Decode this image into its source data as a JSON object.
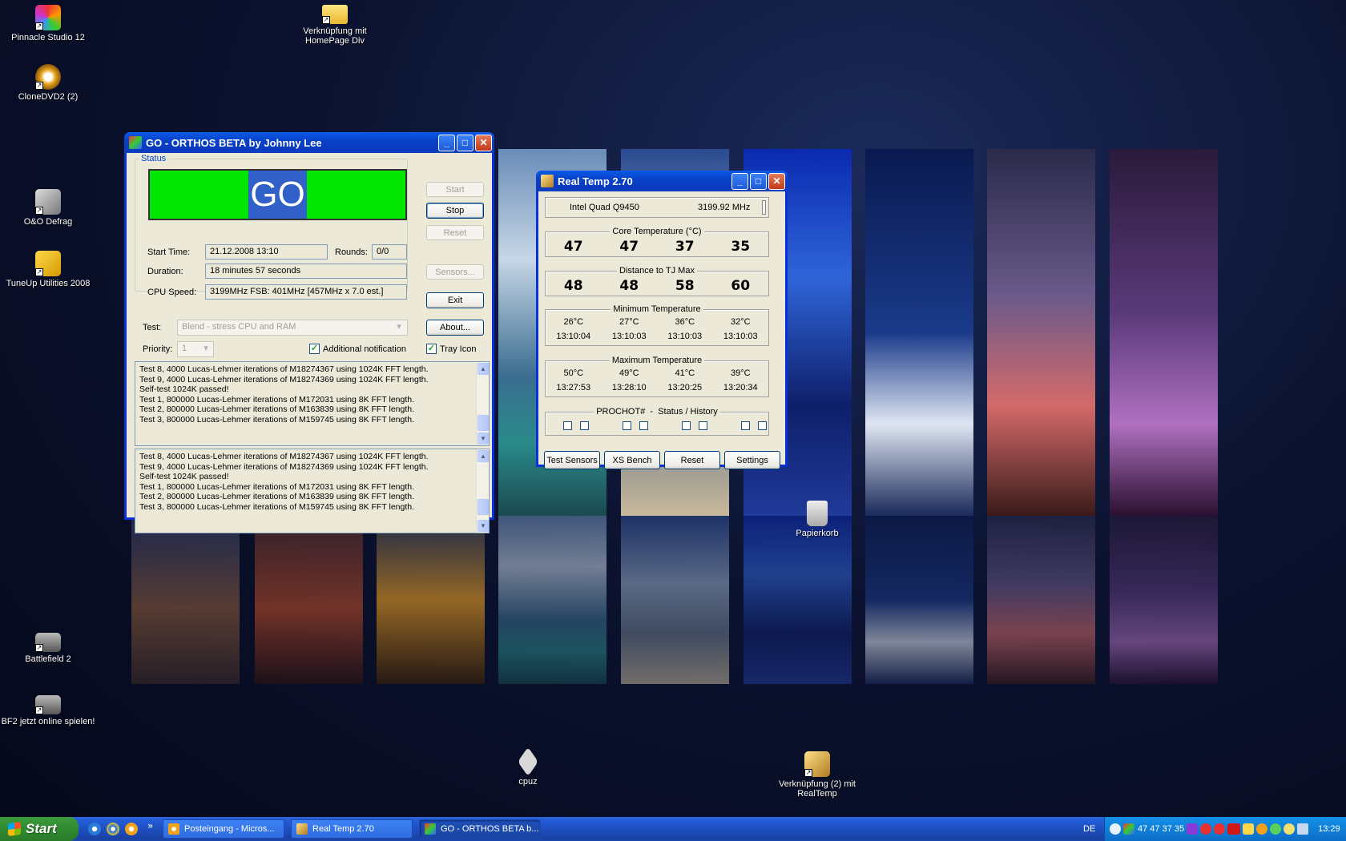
{
  "desktop": {
    "icons": [
      {
        "label": "Pinnacle Studio 12"
      },
      {
        "label": "CloneDVD2 (2)"
      },
      {
        "label": "O&O Defrag"
      },
      {
        "label": "TuneUp Utilities 2008"
      },
      {
        "label": "Battlefield 2"
      },
      {
        "label": "BF2 jetzt online spielen!"
      },
      {
        "label": "Verknüpfung mit HomePage Div"
      },
      {
        "label": "Papierkorb"
      },
      {
        "label": "cpuz"
      },
      {
        "label": "Verknüpfung (2) mit RealTemp"
      }
    ]
  },
  "orthos": {
    "title": "GO - ORTHOS BETA by Johnny Lee",
    "status_group": "Status",
    "status_text": "GO",
    "status_color": "#00e600",
    "start_label": "Start",
    "stop_label": "Stop",
    "reset_label": "Reset",
    "sensors_label": "Sensors...",
    "exit_label": "Exit",
    "about_label": "About...",
    "start_time_label": "Start Time:",
    "start_time": "21.12.2008 13:10",
    "rounds_label": "Rounds:",
    "rounds": "0/0",
    "duration_label": "Duration:",
    "duration": "18 minutes 57 seconds",
    "cpu_speed_label": "CPU Speed:",
    "cpu_speed": "3199MHz FSB: 401MHz [457MHz x 7.0 est.]",
    "test_label": "Test:",
    "test_value": "Blend - stress CPU and RAM",
    "priority_label": "Priority:",
    "priority_value": "1",
    "additional_notification": "Additional notification",
    "tray_icon": "Tray Icon",
    "log1": [
      "Test 8, 4000 Lucas-Lehmer iterations of M18274367 using 1024K FFT length.",
      "Test 9, 4000 Lucas-Lehmer iterations of M18274369 using 1024K FFT length.",
      "Self-test 1024K passed!",
      "Test 1, 800000 Lucas-Lehmer iterations of M172031 using 8K FFT length.",
      "Test 2, 800000 Lucas-Lehmer iterations of M163839 using 8K FFT length.",
      "Test 3, 800000 Lucas-Lehmer iterations of M159745 using 8K FFT length."
    ],
    "log2": [
      "Test 8, 4000 Lucas-Lehmer iterations of M18274367 using 1024K FFT length.",
      "Test 9, 4000 Lucas-Lehmer iterations of M18274369 using 1024K FFT length.",
      "Self-test 1024K passed!",
      "Test 1, 800000 Lucas-Lehmer iterations of M172031 using 8K FFT length.",
      "Test 2, 800000 Lucas-Lehmer iterations of M163839 using 8K FFT length.",
      "Test 3, 800000 Lucas-Lehmer iterations of M159745 using 8K FFT length."
    ]
  },
  "realtemp": {
    "title": "Real Temp 2.70",
    "cpu_name": "Intel Quad Q9450",
    "cpu_mhz": "3199.92 MHz",
    "core_temp_title": "Core Temperature (°C)",
    "core_temps": [
      "47",
      "47",
      "37",
      "35"
    ],
    "tjmax_title": "Distance to TJ Max",
    "tjmax": [
      "48",
      "48",
      "58",
      "60"
    ],
    "min_title": "Minimum Temperature",
    "min_temps": [
      "26°C",
      "27°C",
      "36°C",
      "32°C"
    ],
    "min_times": [
      "13:10:04",
      "13:10:03",
      "13:10:03",
      "13:10:03"
    ],
    "max_title": "Maximum Temperature",
    "max_temps": [
      "50°C",
      "49°C",
      "41°C",
      "39°C"
    ],
    "max_times": [
      "13:27:53",
      "13:28:10",
      "13:20:25",
      "13:20:34"
    ],
    "prochot_title": "PROCHOT#  -  Status / History",
    "test_sensors_label": "Test Sensors",
    "xs_bench_label": "XS Bench",
    "reset_label": "Reset",
    "settings_label": "Settings"
  },
  "taskbar": {
    "start_label": "Start",
    "quicklaunch_more": "»",
    "items": [
      {
        "label": "Posteingang - Micros..."
      },
      {
        "label": "Real Temp 2.70"
      },
      {
        "label": "GO - ORTHOS BETA b..."
      }
    ],
    "language": "DE",
    "tray_temps": "47 47 37 35",
    "clock": "13:29"
  }
}
